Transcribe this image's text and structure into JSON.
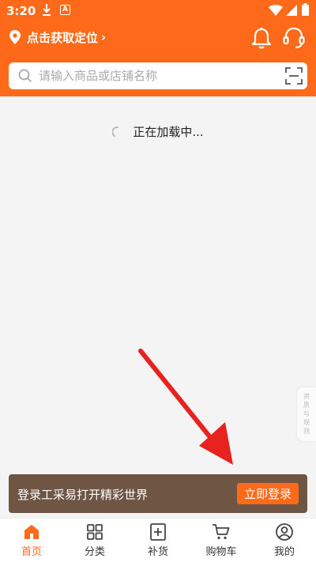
{
  "status_bar": {
    "time": "3:20",
    "badge_letter": "A"
  },
  "header": {
    "location_label": "点击获取定位",
    "location_chevron": "›"
  },
  "search": {
    "placeholder": "请输入商品或店铺名称"
  },
  "content": {
    "loading_text": "正在加载中..."
  },
  "side_tab": {
    "label": "资质与规则"
  },
  "login_banner": {
    "message": "登录工采易打开精彩世界",
    "button_label": "立即登录"
  },
  "tabbar": {
    "items": [
      {
        "label": "首页",
        "icon": "home-icon",
        "active": true
      },
      {
        "label": "分类",
        "icon": "category-grid-icon",
        "active": false
      },
      {
        "label": "补货",
        "icon": "restock-icon",
        "active": false
      },
      {
        "label": "购物车",
        "icon": "cart-icon",
        "active": false
      },
      {
        "label": "我的",
        "icon": "profile-icon",
        "active": false
      }
    ]
  },
  "colors": {
    "brand": "#ff6a1a",
    "banner_bg": "#6e5544",
    "annotation_arrow": "#e8231f"
  }
}
